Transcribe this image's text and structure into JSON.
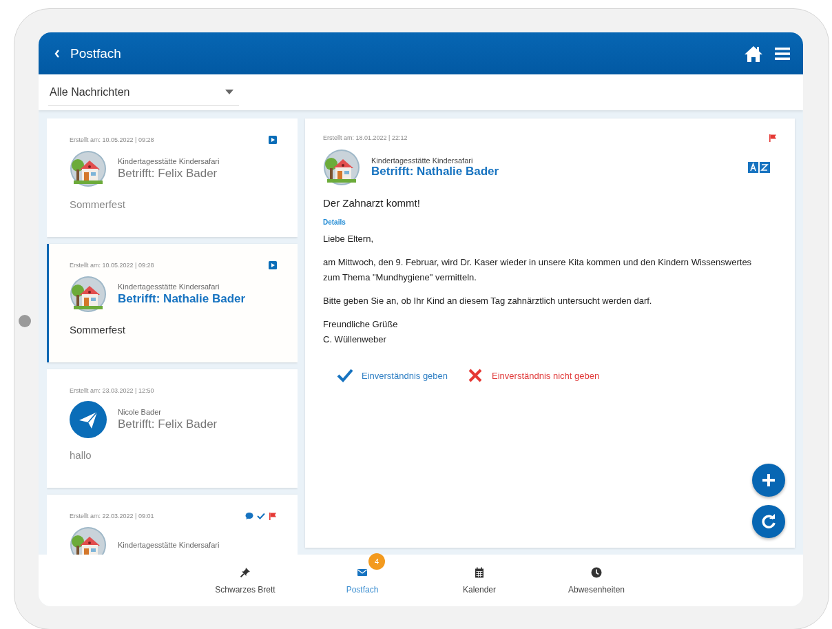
{
  "header": {
    "title": "Postfach"
  },
  "filter": {
    "value": "Alle Nachrichten"
  },
  "messages": [
    {
      "date": "Erstellt am: 10.05.2022 | 09:28",
      "has_note": true,
      "commented": false,
      "confirmed": false,
      "flagged": false,
      "kind": "institution",
      "sender": "Kindertagesstätte Kindersafari",
      "subject": "Betrifft: Felix Bader",
      "preview": "Sommerfest",
      "selected": false
    },
    {
      "date": "Erstellt am: 10.05.2022 | 09:28",
      "has_note": true,
      "commented": false,
      "confirmed": false,
      "flagged": false,
      "kind": "institution",
      "sender": "Kindertagesstätte Kindersafari",
      "subject": "Betrifft: Nathalie Bader",
      "preview": "Sommerfest",
      "selected": true
    },
    {
      "date": "Erstellt am: 23.03.2022 | 12:50",
      "has_note": false,
      "commented": false,
      "confirmed": false,
      "flagged": false,
      "kind": "person",
      "sender": "Nicole Bader",
      "subject": "Betrifft: Felix Bader",
      "preview": "hallo",
      "selected": false
    },
    {
      "date": "Erstellt am: 22.03.2022 | 09:01",
      "has_note": false,
      "commented": true,
      "confirmed": true,
      "flagged": true,
      "kind": "institution",
      "sender": "Kindertagesstätte Kindersafari",
      "selected": false
    }
  ],
  "detail": {
    "date": "Erstellt am: 18.01.2022 | 22:12",
    "flagged": true,
    "kind": "institution",
    "sender": "Kindertagesstätte Kindersafari",
    "subject": "Betrifft: Nathalie Bader",
    "title": "Der Zahnarzt kommt!",
    "details_link": "Details",
    "body": [
      "Liebe Eltern,",
      "am Mittwoch, den 9. Februar, wird Dr. Kaser wieder in unsere Kita kommen und den Kindern Wissenswertes zum Thema \"Mundhygiene\" vermitteln.",
      "Bitte geben Sie an, ob Ihr Kind an diesem Tag zahnärztlich untersucht werden darf.",
      "Freundliche Grüße\nC. Wüllenweber"
    ],
    "actions": [
      {
        "kind": "accept",
        "label": "Einverständnis geben"
      },
      {
        "kind": "decline",
        "label": "Einverständnis nicht geben"
      }
    ]
  },
  "nav": [
    {
      "label": "Schwarzes Brett",
      "selected": false
    },
    {
      "label": "Postfach",
      "selected": true,
      "badge": "4"
    },
    {
      "label": "Kalender",
      "selected": false
    },
    {
      "label": "Abwesenheiten",
      "selected": false
    }
  ]
}
